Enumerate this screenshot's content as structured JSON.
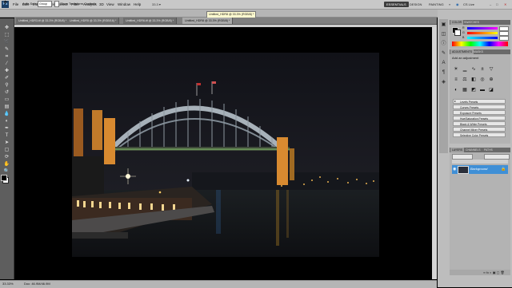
{
  "app": {
    "logo": "Ps"
  },
  "menu": [
    "File",
    "Edit",
    "Image",
    "Layer",
    "Select",
    "Filter",
    "Analysis",
    "3D",
    "View",
    "Window",
    "Help"
  ],
  "workspace": {
    "active": "ESSENTIALS",
    "design": "DESIGN",
    "painting": "PAINTING",
    "more": "»",
    "cs_live": "CS Live"
  },
  "options_bar": {
    "auto_select_label": "Auto-Select:",
    "auto_select_value": "Group",
    "transform_label": "Show Transform Controls"
  },
  "tabs": [
    {
      "label": "Untitled_HDR3.tif @ 33.3% (RGB/8) *",
      "active": false
    },
    {
      "label": "Untitled_HDR5 @ 33.3% (RGB/16) *",
      "active": false
    },
    {
      "label": "Untitled_HDR6.tif @ 33.3% (RGB/8) *",
      "active": false
    },
    {
      "label": "Untitled_HDR8 @ 33.3% (RGB/8) *",
      "active": true
    }
  ],
  "tooltip": "Untitled_HDR8 @ 33.3% (RGB/8) *",
  "status": {
    "zoom": "33.33%",
    "doc": "Doc: 46.9M/46.9M"
  },
  "panels": {
    "color": {
      "tabs": [
        "COLOR",
        "SWATCHES"
      ],
      "sliders": [
        "R",
        "G",
        "B"
      ]
    },
    "adjustments": {
      "tabs": [
        "ADJUSTMENTS",
        "MASKS"
      ],
      "title": "Add an adjustment",
      "presets": [
        "Levels Presets",
        "Curves Presets",
        "Exposure Presets",
        "Hue/Saturation Presets",
        "Black & White Presets",
        "Channel Mixer Presets",
        "Selective Color Presets"
      ]
    },
    "layers": {
      "tabs": [
        "LAYERS",
        "CHANNELS",
        "PATHS"
      ],
      "layer_name": "Background"
    }
  },
  "colors": {
    "ui_light": "#c8c8c8",
    "panel": "#b3b3b3",
    "toolbar": "#5e5e5e",
    "selection_blue": "#3f8fd6",
    "canvas": "#000000"
  }
}
